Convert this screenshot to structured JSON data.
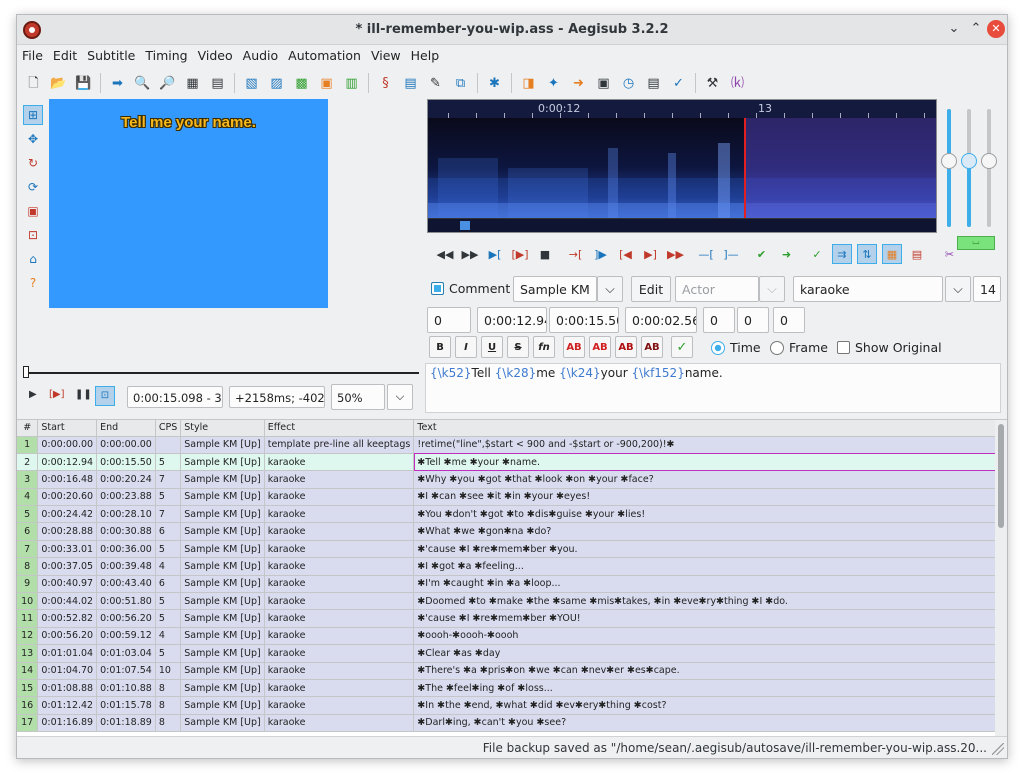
{
  "window": {
    "title": "* ill-remember-you-wip.ass - Aegisub 3.2.2",
    "controls": [
      "⌄",
      "⌃",
      "✕"
    ]
  },
  "menu": [
    "File",
    "Edit",
    "Subtitle",
    "Timing",
    "Video",
    "Audio",
    "Automation",
    "View",
    "Help"
  ],
  "toolbar": {
    "icons": [
      "new-file-icon",
      "open-folder-icon",
      "save-icon",
      "arrow-right-icon",
      "search-icon",
      "find-replace-icon",
      "styles-manager-icon",
      "attachments-icon",
      "properties-icon",
      "fonts-collector-icon",
      "resample-icon",
      "translation-icon",
      "spell-check-icon",
      "assistant-icon",
      "shift-times-icon",
      "timing-post-processor-icon",
      "kanji-timer-icon",
      "automation-icon",
      "options-icon",
      "hotkeys-icon"
    ]
  },
  "video": {
    "subtitle_preview": "Tell me your name.",
    "time": "0:00:15.098 - 3",
    "offset": "+2158ms; -402",
    "zoom": "50%"
  },
  "audio": {
    "ruler": {
      "label_time": "0:00:12",
      "label_sec": "13"
    },
    "badge": "⌴"
  },
  "edit": {
    "comment_label": "Comment",
    "comment_checked": true,
    "style": "Sample KM",
    "edit_label": "Edit",
    "actor_placeholder": "Actor",
    "effect": "karaoke",
    "layer_right": "14",
    "layer": "0",
    "start": "0:00:12.94",
    "end": "0:00:15.50",
    "duration": "0:00:02.56",
    "margin_l": "0",
    "margin_r": "0",
    "margin_v": "0",
    "format": {
      "bold": "B",
      "italic": "I",
      "underline": "U",
      "strike": "S",
      "font": "fn",
      "colors": [
        "AB",
        "AB",
        "AB",
        "AB"
      ]
    },
    "time_label": "Time",
    "frame_label": "Frame",
    "show_original_label": "Show Original",
    "text_parts": [
      {
        "t": "{\\k52}",
        "tag": true
      },
      {
        "t": "Tell ",
        "tag": false
      },
      {
        "t": "{\\k28}",
        "tag": true
      },
      {
        "t": "me ",
        "tag": false
      },
      {
        "t": "{\\k24}",
        "tag": true
      },
      {
        "t": "your ",
        "tag": false
      },
      {
        "t": "{\\kf152}",
        "tag": true
      },
      {
        "t": "name.",
        "tag": false
      }
    ]
  },
  "grid": {
    "columns": [
      "#",
      "Start",
      "End",
      "CPS",
      "Style",
      "Effect",
      "Text"
    ],
    "rows": [
      [
        "1",
        "0:00:00.00",
        "0:00:00.00",
        "",
        "Sample KM [Up]",
        "template pre-line all keeptags",
        "!retime(\"line\",$start < 900 and -$start or -900,200)!✱"
      ],
      [
        "2",
        "0:00:12.94",
        "0:00:15.50",
        "5",
        "Sample KM [Up]",
        "karaoke",
        "✱Tell ✱me ✱your ✱name."
      ],
      [
        "3",
        "0:00:16.48",
        "0:00:20.24",
        "7",
        "Sample KM [Up]",
        "karaoke",
        "✱Why ✱you ✱got ✱that ✱look ✱on ✱your ✱face?"
      ],
      [
        "4",
        "0:00:20.60",
        "0:00:23.88",
        "5",
        "Sample KM [Up]",
        "karaoke",
        "✱I ✱can ✱see ✱it ✱in ✱your ✱eyes!"
      ],
      [
        "5",
        "0:00:24.42",
        "0:00:28.10",
        "7",
        "Sample KM [Up]",
        "karaoke",
        "✱You ✱don't ✱got ✱to ✱dis✱guise ✱your ✱lies!"
      ],
      [
        "6",
        "0:00:28.88",
        "0:00:30.88",
        "6",
        "Sample KM [Up]",
        "karaoke",
        "✱What ✱we ✱gon✱na ✱do?"
      ],
      [
        "7",
        "0:00:33.01",
        "0:00:36.00",
        "5",
        "Sample KM [Up]",
        "karaoke",
        "✱'cause ✱I ✱re✱mem✱ber ✱you."
      ],
      [
        "8",
        "0:00:37.05",
        "0:00:39.48",
        "4",
        "Sample KM [Up]",
        "karaoke",
        "✱I ✱got ✱a ✱feeling..."
      ],
      [
        "9",
        "0:00:40.97",
        "0:00:43.40",
        "6",
        "Sample KM [Up]",
        "karaoke",
        "✱I'm ✱caught ✱in ✱a ✱loop..."
      ],
      [
        "10",
        "0:00:44.02",
        "0:00:51.80",
        "5",
        "Sample KM [Up]",
        "karaoke",
        "✱Doomed ✱to ✱make ✱the ✱same ✱mis✱takes, ✱in ✱eve✱ry✱thing ✱I ✱do."
      ],
      [
        "11",
        "0:00:52.82",
        "0:00:56.20",
        "5",
        "Sample KM [Up]",
        "karaoke",
        "✱'cause ✱I ✱re✱mem✱ber ✱YOU!"
      ],
      [
        "12",
        "0:00:56.20",
        "0:00:59.12",
        "4",
        "Sample KM [Up]",
        "karaoke",
        "✱oooh-✱oooh-✱oooh"
      ],
      [
        "13",
        "0:01:01.04",
        "0:01:03.04",
        "5",
        "Sample KM [Up]",
        "karaoke",
        "✱Clear ✱as ✱day"
      ],
      [
        "14",
        "0:01:04.70",
        "0:01:07.54",
        "10",
        "Sample KM [Up]",
        "karaoke",
        "✱There's ✱a ✱pris✱on ✱we ✱can ✱nev✱er ✱es✱cape."
      ],
      [
        "15",
        "0:01:08.88",
        "0:01:10.88",
        "8",
        "Sample KM [Up]",
        "karaoke",
        "✱The ✱feel✱ing ✱of ✱loss..."
      ],
      [
        "16",
        "0:01:12.42",
        "0:01:15.78",
        "8",
        "Sample KM [Up]",
        "karaoke",
        "✱In ✱the ✱end, ✱what ✱did ✱ev✱ery✱thing ✱cost?"
      ],
      [
        "17",
        "0:01:16.89",
        "0:01:18.89",
        "8",
        "Sample KM [Up]",
        "karaoke",
        "✱Darl✱ing, ✱can't ✱you ✱see?"
      ]
    ],
    "selected_row": 1
  },
  "status": "File backup saved as \"/home/sean/.aegisub/autosave/ill-remember-you-wip.ass.20..."
}
